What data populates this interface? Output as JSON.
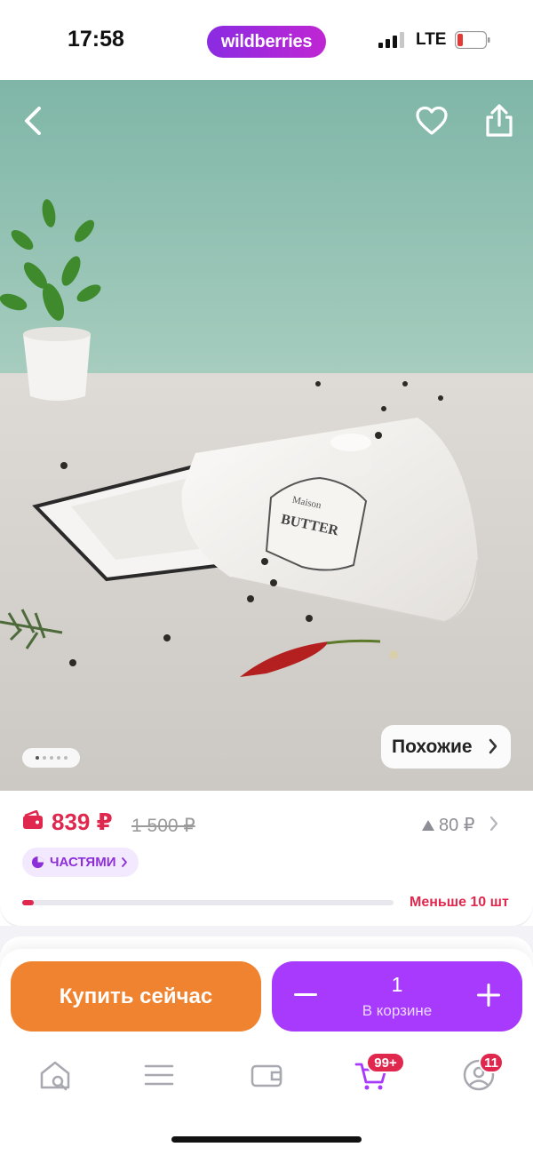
{
  "status_bar": {
    "time": "17:58",
    "brand": "wildberries",
    "network": "LTE",
    "brand_color": "#a73afd"
  },
  "hero": {
    "icons": [
      "back-arrow-icon",
      "heart-icon",
      "share-icon"
    ],
    "gallery_images": 5,
    "gallery_index": 1,
    "similar_label": "Похожие"
  },
  "price": {
    "current": "839 ₽",
    "old": "1 500 ₽",
    "delta": "80 ₽",
    "installments_label": "ЧАСТЯМИ",
    "stock_label": "Меньше 10 шт",
    "stock_fraction": 0.03,
    "price_color": "#e0284f"
  },
  "actions": {
    "buy_now_label": "Купить сейчас",
    "quantity": "1",
    "in_cart_label": "В корзине",
    "buy_color": "#f0832f",
    "cart_color": "#a73afd"
  },
  "tabbar": {
    "tabs": [
      "home-search-icon",
      "catalog-icon",
      "wallet-icon",
      "cart-icon",
      "profile-icon"
    ],
    "cart_badge": "99+",
    "profile_badge": "11"
  }
}
